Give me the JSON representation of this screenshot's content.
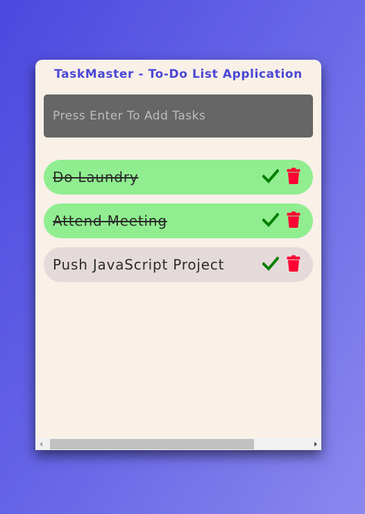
{
  "app": {
    "title": "TaskMaster - To-Do List Application"
  },
  "input": {
    "placeholder": "Press Enter To Add Tasks",
    "value": ""
  },
  "tasks": [
    {
      "text": "Do Laundry",
      "completed": true
    },
    {
      "text": "Attend Meeting",
      "completed": true
    },
    {
      "text": "Push JavaScript Project",
      "completed": false
    }
  ],
  "icons": {
    "complete": "check-icon",
    "delete": "trash-icon"
  },
  "colors": {
    "title": "#4b47d6",
    "completed_bg": "#90ee90",
    "pending_bg": "#e5dada",
    "check": "#008000",
    "trash": "#ff0033",
    "input_bg": "#666666",
    "card_bg": "#f9f0e8"
  }
}
